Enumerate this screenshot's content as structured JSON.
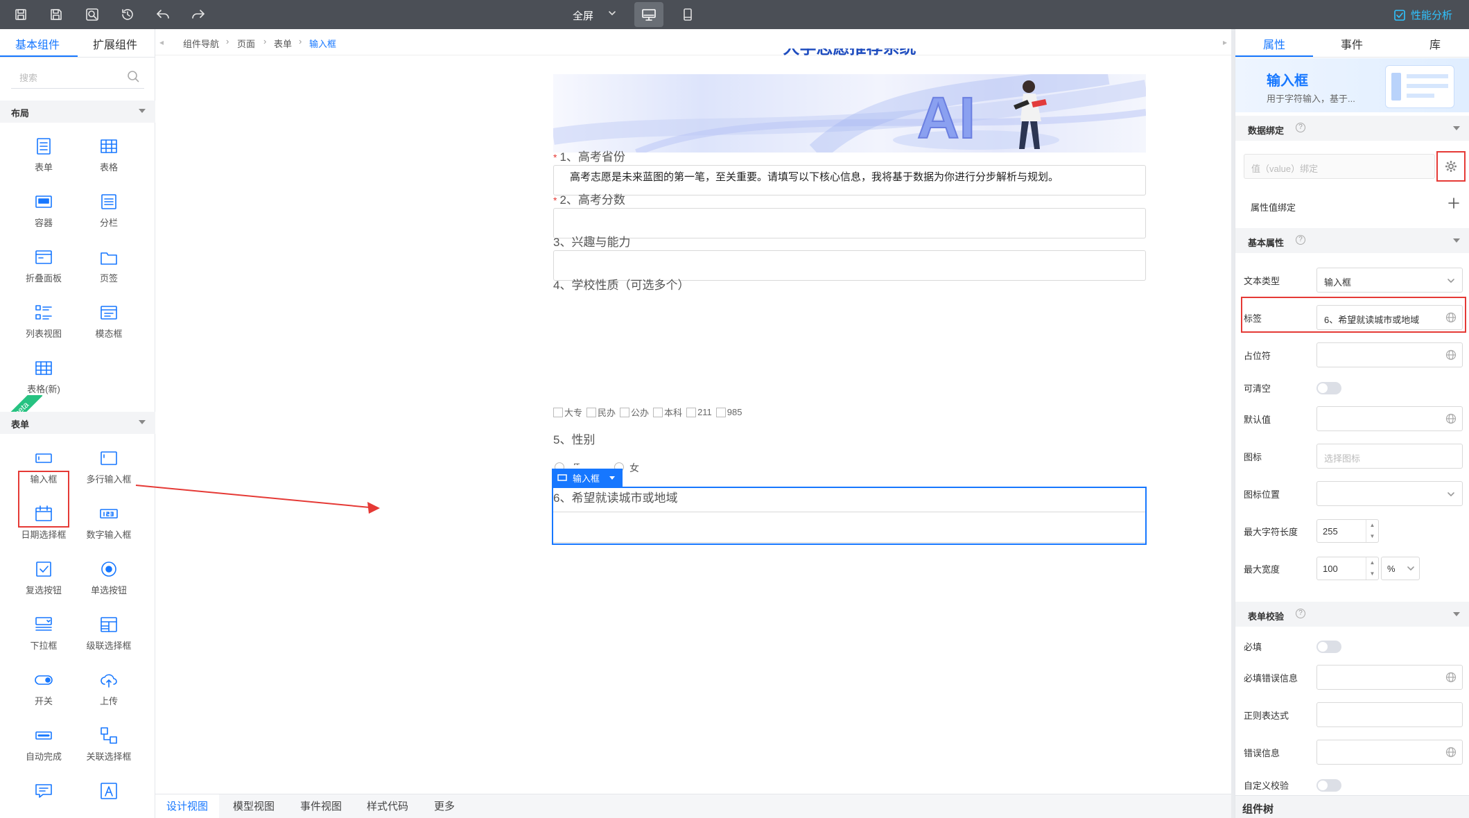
{
  "toolbar": {
    "fullscreen_label": "全屏",
    "perf_label": "性能分析"
  },
  "left_panel": {
    "tabs": [
      {
        "label": "基本组件"
      },
      {
        "label": "扩展组件"
      }
    ],
    "search_placeholder": "搜索",
    "sections": [
      {
        "title": "布局",
        "items": [
          {
            "label": "表单",
            "icon": "form-icon"
          },
          {
            "label": "表格",
            "icon": "table-icon"
          },
          {
            "label": "容器",
            "icon": "container-icon"
          },
          {
            "label": "分栏",
            "icon": "columns-icon"
          },
          {
            "label": "折叠面板",
            "icon": "collapse-icon"
          },
          {
            "label": "页签",
            "icon": "tabs-icon"
          },
          {
            "label": "列表视图",
            "icon": "list-view-icon"
          },
          {
            "label": "模态框",
            "icon": "modal-icon"
          },
          {
            "label": "表格(新)",
            "icon": "table-new-icon"
          }
        ]
      },
      {
        "title": "表单",
        "items": [
          {
            "label": "输入框",
            "icon": "input-icon"
          },
          {
            "label": "多行输入框",
            "icon": "textarea-icon"
          },
          {
            "label": "日期选择框",
            "icon": "date-picker-icon"
          },
          {
            "label": "数字输入框",
            "icon": "number-input-icon"
          },
          {
            "label": "复选按钮",
            "icon": "checkbox-icon"
          },
          {
            "label": "单选按钮",
            "icon": "radio-icon"
          },
          {
            "label": "下拉框",
            "icon": "select-icon"
          },
          {
            "label": "级联选择框",
            "icon": "cascader-icon"
          },
          {
            "label": "开关",
            "icon": "switch-icon"
          },
          {
            "label": "上传",
            "icon": "upload-icon"
          },
          {
            "label": "自动完成",
            "icon": "autocomplete-icon"
          },
          {
            "label": "关联选择框",
            "icon": "relation-select-icon"
          }
        ]
      }
    ],
    "beta_badge": "beta"
  },
  "breadcrumb": [
    "组件导航",
    "页面",
    "表单",
    "输入框"
  ],
  "canvas": {
    "page_heading": "大学志愿推荐系统",
    "banner_logo": "AI",
    "intro": "高考志愿是未来蓝图的第一笔，至关重要。请填写以下核心信息，我将基于数据为你进行分步解析与规划。",
    "questions": [
      {
        "label": "1、高考省份",
        "required": true
      },
      {
        "label": "2、高考分数",
        "required": true
      },
      {
        "label": "3、兴趣与能力",
        "required": false
      },
      {
        "label": "4、学校性质（可选多个）",
        "required": false
      },
      {
        "label": "5、性别",
        "required": false
      }
    ],
    "school_options": [
      "大专",
      "民办",
      "公办",
      "本科",
      "211",
      "985"
    ],
    "gender_options": [
      "男",
      "女"
    ],
    "selected_tag": "输入框",
    "selected_label": "6、希望就读城市或地域"
  },
  "bottom_tabs": [
    "设计视图",
    "模型视图",
    "事件视图",
    "样式代码",
    "更多"
  ],
  "right_panel": {
    "tabs": [
      "属性",
      "事件",
      "库"
    ],
    "component_title": "输入框",
    "component_desc": "用于字符输入，基于...",
    "sections": {
      "data_binding": "数据绑定",
      "basic": "基本属性",
      "validation": "表单校验"
    },
    "binding_placeholder": "值（value）绑定",
    "attr_binding_label": "属性值绑定",
    "props": {
      "text_type_label": "文本类型",
      "text_type_value": "输入框",
      "label_label": "标签",
      "label_value": "6、希望就读城市或地域",
      "placeholder_label": "占位符",
      "clearable_label": "可清空",
      "default_label": "默认值",
      "icon_label": "图标",
      "icon_placeholder": "选择图标",
      "icon_pos_label": "图标位置",
      "maxlen_label": "最大字符长度",
      "maxlen_value": "255",
      "maxwidth_label": "最大宽度",
      "maxwidth_value": "100",
      "maxwidth_unit": "%"
    },
    "validation": {
      "required_label": "必填",
      "required_msg_label": "必填错误信息",
      "regex_label": "正则表达式",
      "error_msg_label": "错误信息",
      "custom_label": "自定义校验"
    },
    "component_tree": "组件树"
  },
  "colors": {
    "accent": "#1677ff",
    "highlight": "#e53935",
    "toolbar": "#4b4f56"
  }
}
